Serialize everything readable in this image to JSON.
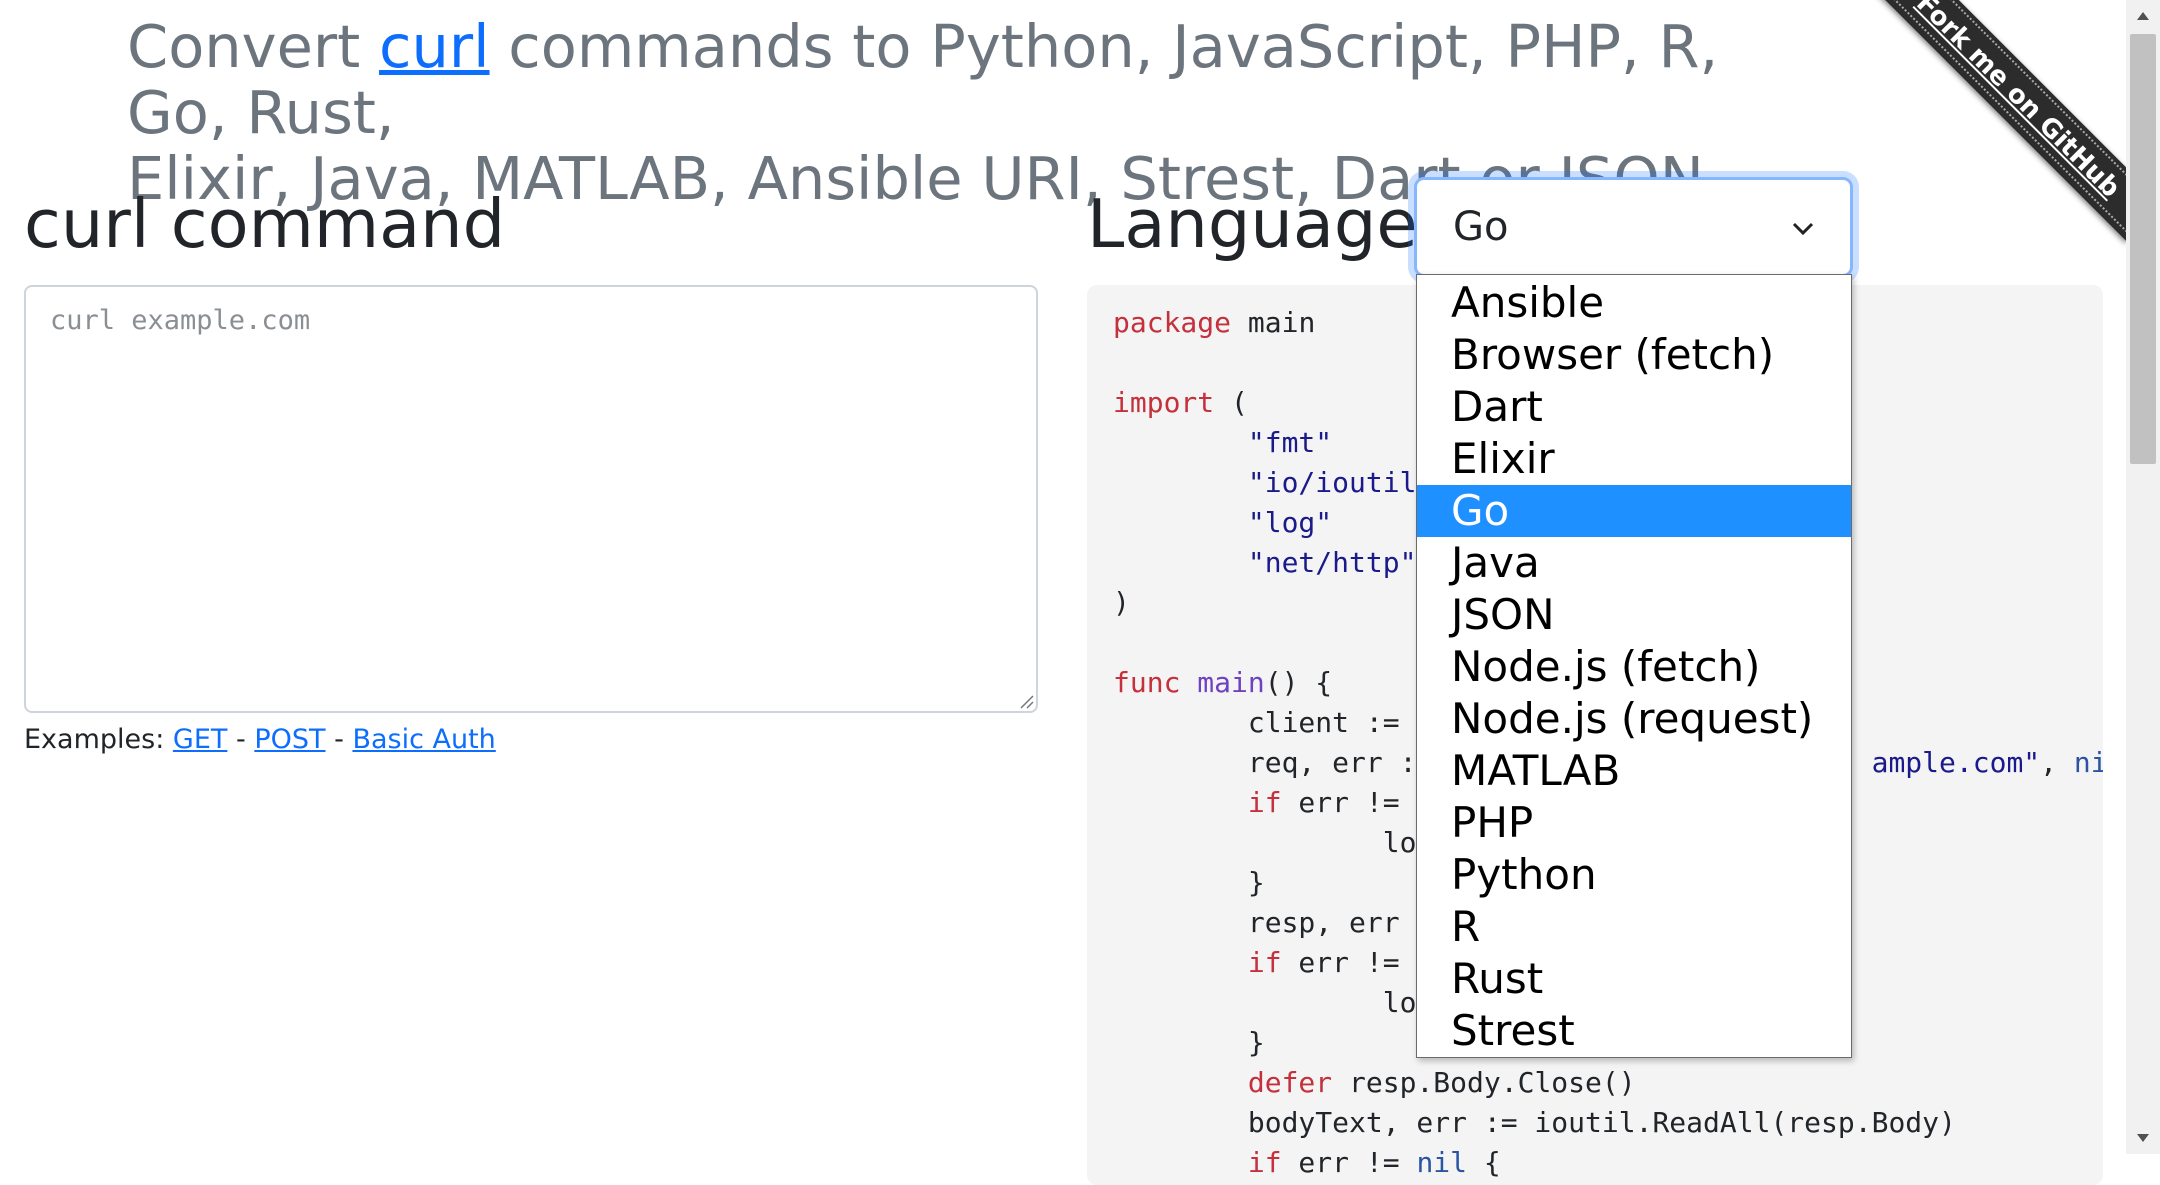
{
  "header": {
    "prefix": "Convert ",
    "curl_link": "curl",
    "rest_line1": " commands to Python, JavaScript, PHP, R, Go, Rust,",
    "line2": "Elixir, Java, MATLAB, Ansible URI, Strest, Dart or JSON"
  },
  "left": {
    "title": "curl command",
    "input_placeholder": "curl example.com",
    "examples_label": "Examples:",
    "examples": [
      "GET",
      "POST",
      "Basic Auth"
    ],
    "separator": "-"
  },
  "right": {
    "language_label": "Language:",
    "selected_language": "Go",
    "options": [
      "Ansible",
      "Browser (fetch)",
      "Dart",
      "Elixir",
      "Go",
      "Java",
      "JSON",
      "Node.js (fetch)",
      "Node.js (request)",
      "MATLAB",
      "PHP",
      "Python",
      "R",
      "Rust",
      "Strest"
    ]
  },
  "code": {
    "lines": [
      "package main",
      "",
      "import (",
      "        \"fmt\"",
      "        \"io/ioutil\"",
      "        \"log\"",
      "        \"net/http\"",
      ")",
      "",
      "func main() {",
      "        client := &",
      "        req, err :=                          ample.com\", nil)",
      "        if err != n",
      "                log",
      "        }",
      "        resp, err :",
      "        if err != n",
      "                log",
      "        }",
      "        defer resp.Body.Close()",
      "        bodyText, err := ioutil.ReadAll(resp.Body)",
      "        if err != nil {"
    ]
  },
  "ribbon": {
    "text": "Fork me on GitHub"
  },
  "icons": {
    "select_chevron": "chevron-down-icon",
    "resize": "resize-handle-icon",
    "scroll_up": "arrow-up-icon",
    "scroll_down": "arrow-down-icon"
  },
  "colors": {
    "link": "#0d6efd",
    "selected_option_bg": "#1e90ff",
    "keyword": "#c4303c",
    "function": "#6f42c1",
    "heading_muted": "#6c757d",
    "code_bg": "#f4f4f4"
  }
}
